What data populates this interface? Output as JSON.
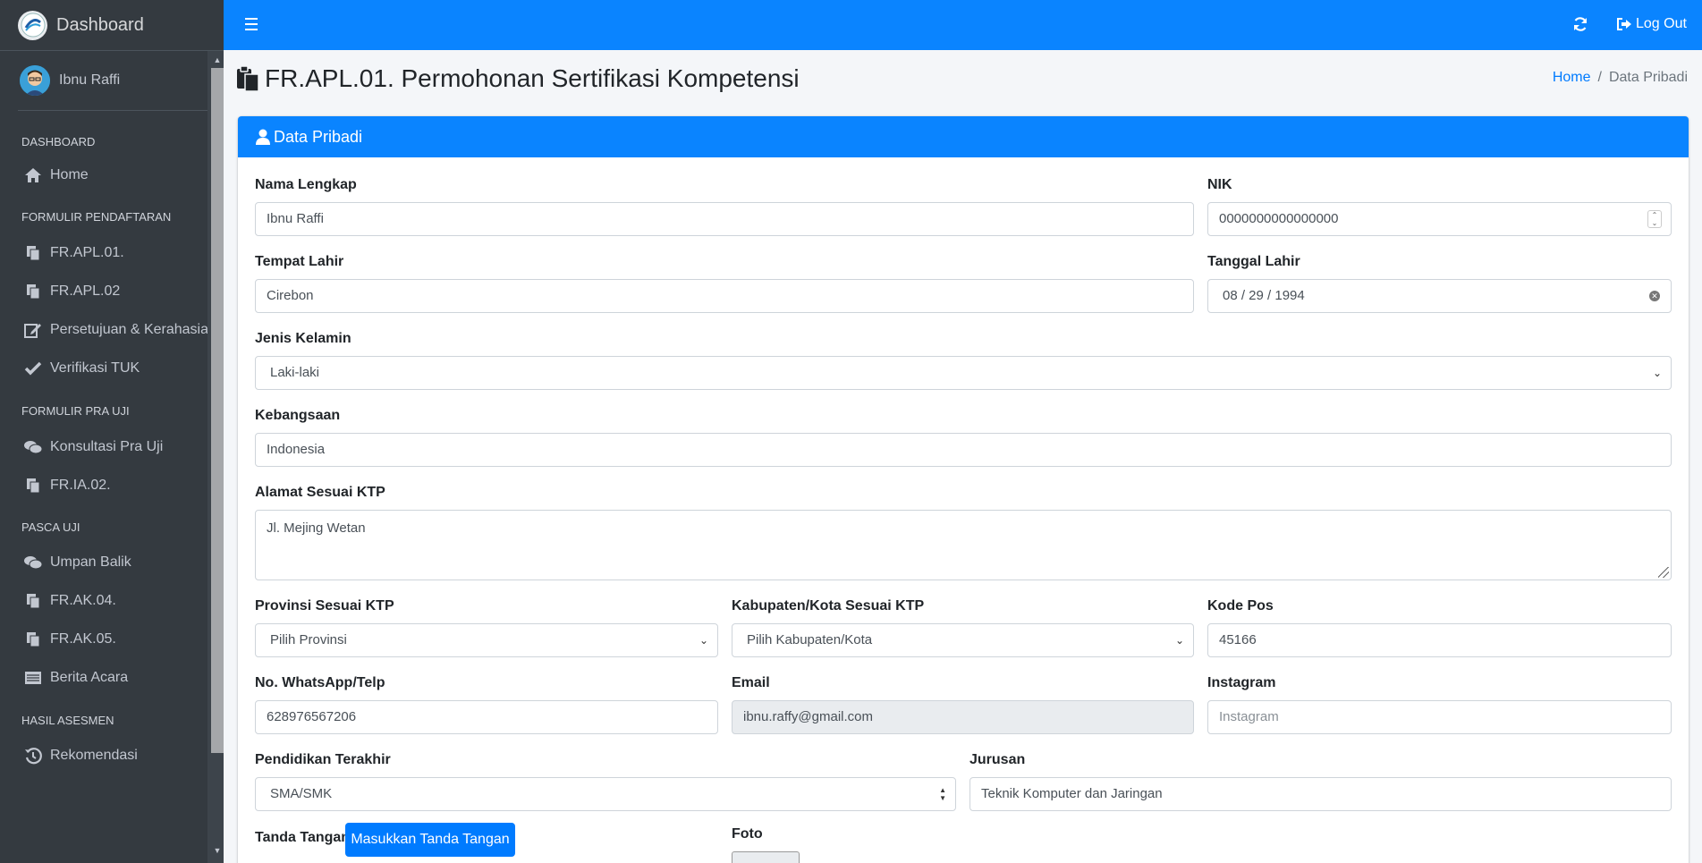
{
  "brand": {
    "title": "Dashboard"
  },
  "user": {
    "name": "Ibnu Raffi"
  },
  "sidebar": {
    "sections": [
      {
        "header": "DASHBOARD",
        "items": [
          {
            "label": "Home",
            "icon": "home-icon"
          }
        ]
      },
      {
        "header": "FORMULIR PENDAFTARAN",
        "items": [
          {
            "label": "FR.APL.01.",
            "icon": "copy-icon"
          },
          {
            "label": "FR.APL.02",
            "icon": "copy-icon"
          },
          {
            "label": "Persetujuan & Kerahasiaa",
            "icon": "edit-icon"
          },
          {
            "label": "Verifikasi TUK",
            "icon": "check-icon"
          }
        ]
      },
      {
        "header": "FORMULIR PRA UJI",
        "items": [
          {
            "label": "Konsultasi Pra Uji",
            "icon": "comments-icon"
          },
          {
            "label": "FR.IA.02.",
            "icon": "copy-icon"
          }
        ]
      },
      {
        "header": "PASCA UJI",
        "items": [
          {
            "label": "Umpan Balik",
            "icon": "comments-icon"
          },
          {
            "label": "FR.AK.04.",
            "icon": "copy-icon"
          },
          {
            "label": "FR.AK.05.",
            "icon": "copy-icon"
          },
          {
            "label": "Berita Acara",
            "icon": "list-icon"
          }
        ]
      },
      {
        "header": "HASIL ASESMEN",
        "items": [
          {
            "label": "Rekomendasi",
            "icon": "history-icon"
          }
        ]
      }
    ]
  },
  "topbar": {
    "logout_label": "Log Out"
  },
  "page": {
    "title": "FR.APL.01. Permohonan Sertifikasi Kompetensi"
  },
  "breadcrumb": {
    "home": "Home",
    "current": "Data Pribadi"
  },
  "card": {
    "title": "Data Pribadi"
  },
  "form": {
    "nama_label": "Nama Lengkap",
    "nama_value": "Ibnu Raffi",
    "nik_label": "NIK",
    "nik_value": "0000000000000000",
    "tempat_label": "Tempat Lahir",
    "tempat_value": "Cirebon",
    "tanggal_label": "Tanggal Lahir",
    "tanggal_value": "08 / 29 / 1994",
    "jk_label": "Jenis Kelamin",
    "jk_value": "Laki-laki",
    "bangsa_label": "Kebangsaan",
    "bangsa_value": "Indonesia",
    "alamat_label": "Alamat Sesuai KTP",
    "alamat_value": "Jl. Mejing Wetan",
    "provinsi_label": "Provinsi Sesuai KTP",
    "provinsi_value": "Pilih Provinsi",
    "kab_label": "Kabupaten/Kota Sesuai KTP",
    "kab_value": "Pilih Kabupaten/Kota",
    "kodepos_label": "Kode Pos",
    "kodepos_value": "45166",
    "wa_label": "No. WhatsApp/Telp",
    "wa_value": "628976567206",
    "email_label": "Email",
    "email_value": "ibnu.raffy@gmail.com",
    "ig_label": "Instagram",
    "ig_placeholder": "Instagram",
    "pendidikan_label": "Pendidikan Terakhir",
    "pendidikan_value": "SMA/SMK",
    "jurusan_label": "Jurusan",
    "jurusan_value": "Teknik Komputer dan Jaringan",
    "ttd_label": "Tanda Tangan",
    "ttd_button": "Masukkan Tanda Tangan",
    "foto_label": "Foto"
  }
}
